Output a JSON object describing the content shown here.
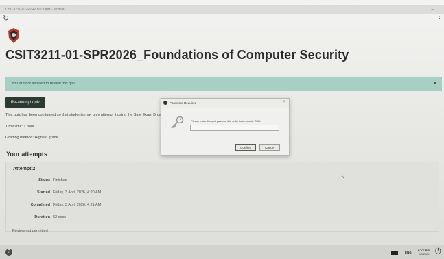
{
  "window": {
    "title": "CSIT3211-01-SPR2026: Quiz - Mozilla"
  },
  "course": {
    "title": "CSIT3211-01-SPR2026_Foundations of Computer Security"
  },
  "alert": {
    "message": "You are not allowed to review this quiz",
    "close_label": "×"
  },
  "quiz": {
    "reattempt_label": "Re-attempt quiz",
    "config_note": "This quiz has been configured so that students may only attempt it using the Safe Exam Browser.",
    "time_limit": "Time limit: 1 hour",
    "grading_method": "Grading method: Highest grade"
  },
  "attempts": {
    "heading": "Your attempts",
    "attempt_title": "Attempt 2",
    "rows": [
      {
        "label": "Status",
        "value": "Finished"
      },
      {
        "label": "Started",
        "value": "Friday, 3 April 2026, 4:20 AM"
      },
      {
        "label": "Completed",
        "value": "Friday, 3 April 2026, 4:21 AM"
      },
      {
        "label": "Duration",
        "value": "52 secs"
      }
    ],
    "review_note": "Review not permitted"
  },
  "dialog": {
    "title": "Password Required",
    "close_label": "×",
    "prompt": "Please enter the quit password in order to terminate SEB:",
    "input_value": "",
    "confirm_label": "Confirm",
    "cancel_label": "Cancel"
  },
  "taskbar": {
    "help_label": "?",
    "language": "ENG",
    "time": "4:22 AM",
    "date": "4/3/2026"
  },
  "icons": {
    "reload": "reload-icon",
    "menu": "menu-icon",
    "key": "key-icon",
    "power": "power-icon",
    "folder": "folder-icon"
  },
  "colors": {
    "alert_bg": "#a8cfc4",
    "alert_text": "#2e5a4e",
    "primary_button": "#2d3a33"
  }
}
